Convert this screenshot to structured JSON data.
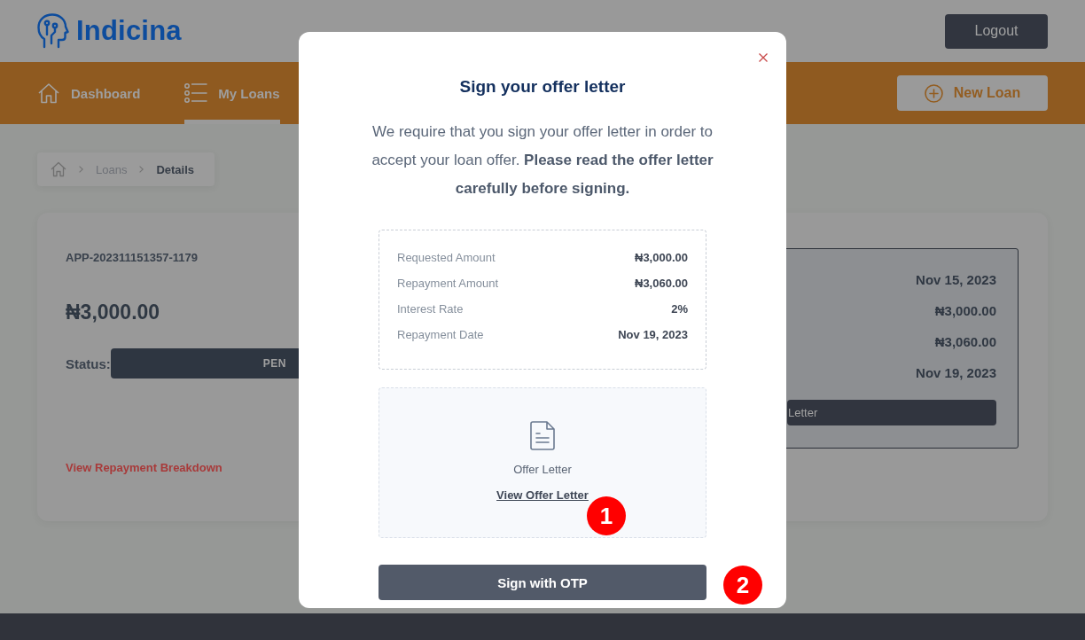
{
  "header": {
    "logo_text": "Indicina",
    "logout_button": "Logout"
  },
  "nav": {
    "items": [
      {
        "label": "Dashboard",
        "kind": "home",
        "selected": false
      },
      {
        "label": "My Loans",
        "kind": "list",
        "selected": true
      }
    ],
    "new_loan_button": "New Loan"
  },
  "breadcrumb": {
    "items": [
      {
        "label": "Loans",
        "current": false
      },
      {
        "label": "Details",
        "current": true
      }
    ]
  },
  "loan_card": {
    "application_id": "APP-202311151357-1179",
    "amount": "₦3,000.00",
    "status_label": "Status:",
    "status_badge": "PEN",
    "breakdown_link": "View Repayment Breakdown",
    "details": {
      "values": [
        "Nov 15, 2023",
        "₦3,000.00",
        "₦3,060.00",
        "Nov 19, 2023"
      ],
      "button": "Letter"
    }
  },
  "modal": {
    "title": "Sign your offer letter",
    "message": "We require that you sign your offer letter in order to accept your loan offer. **Please read the offer letter carefully before signing.**",
    "summary": [
      {
        "label": "Requested Amount",
        "value": "₦3,000.00"
      },
      {
        "label": "Repayment Amount",
        "value": "₦3,060.00"
      },
      {
        "label": "Interest Rate",
        "value": "2%"
      },
      {
        "label": "Repayment Date",
        "value": "Nov 19, 2023"
      }
    ],
    "document": {
      "title": "Offer Letter",
      "link": "View Offer Letter"
    },
    "sign_button": "Sign with OTP"
  },
  "markers": [
    {
      "label": "1"
    },
    {
      "label": "2"
    }
  ]
}
